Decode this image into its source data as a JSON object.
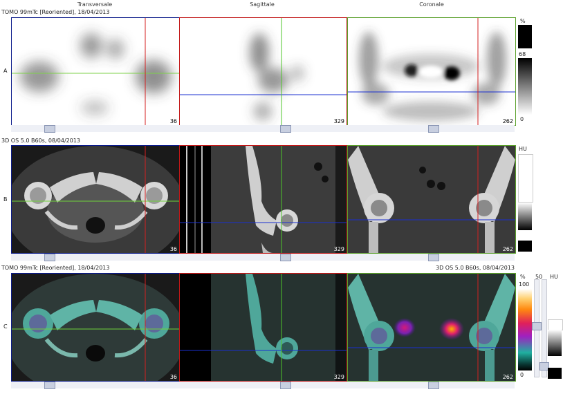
{
  "columns": [
    "Transversale",
    "Sagittale",
    "Coronale"
  ],
  "rows": [
    {
      "letter": "A",
      "series": "TOMO 99mTc [Reoriented], 18/04/2013",
      "slices": [
        "36",
        "329",
        "262"
      ]
    },
    {
      "letter": "B",
      "series": "3D  OS  5.0  B60s, 08/04/2013",
      "slices": [
        "36",
        "329",
        "262"
      ]
    },
    {
      "letter": "C",
      "series": "TOMO 99mTc [Reoriented], 18/04/2013",
      "series_right": "3D  OS  5.0  B60s, 08/04/2013",
      "slices": [
        "36",
        "329",
        "262"
      ]
    }
  ],
  "bars": {
    "a_unit": "%",
    "a_top": "68",
    "a_bottom": "0",
    "b_unit": "HU",
    "c_unit": "%",
    "c_top": "100",
    "c_bottom": "0",
    "c_mid": "50",
    "c_hu_unit": "HU"
  },
  "colors": {
    "frame_transversal": "#0a1a8a",
    "frame_sagittal": "#c21818",
    "frame_coronal": "#5aa02a",
    "crosshair_vertical_red": "#d42020",
    "crosshair_vertical_green": "#4ec62a",
    "crosshair_horizontal_green": "#6fd23a",
    "crosshair_horizontal_blue": "#1a2fd0"
  }
}
